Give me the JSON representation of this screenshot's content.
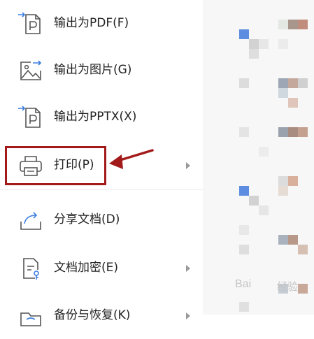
{
  "menu": {
    "items": [
      {
        "label": "输出为PDF(F)",
        "icon": "export-pdf-icon",
        "submenu": false
      },
      {
        "label": "输出为图片(G)",
        "icon": "export-image-icon",
        "submenu": false
      },
      {
        "label": "输出为PPTX(X)",
        "icon": "export-pptx-icon",
        "submenu": false
      },
      {
        "label": "打印(P)",
        "icon": "printer-icon",
        "submenu": true
      },
      {
        "label": "分享文档(D)",
        "icon": "share-icon",
        "submenu": false
      },
      {
        "label": "文档加密(E)",
        "icon": "document-lock-icon",
        "submenu": true
      },
      {
        "label": "备份与恢复(K)",
        "icon": "backup-folder-icon",
        "submenu": true
      }
    ]
  },
  "annotation": {
    "highlight_color": "#a31a1a",
    "highlighted_item": "打印(P)"
  },
  "colors": {
    "icon_stroke": "#555555",
    "icon_accent": "#3d7ee0",
    "chevron": "#999999"
  },
  "watermark": {
    "text_latin": "Bai",
    "text_cn": "经验"
  }
}
